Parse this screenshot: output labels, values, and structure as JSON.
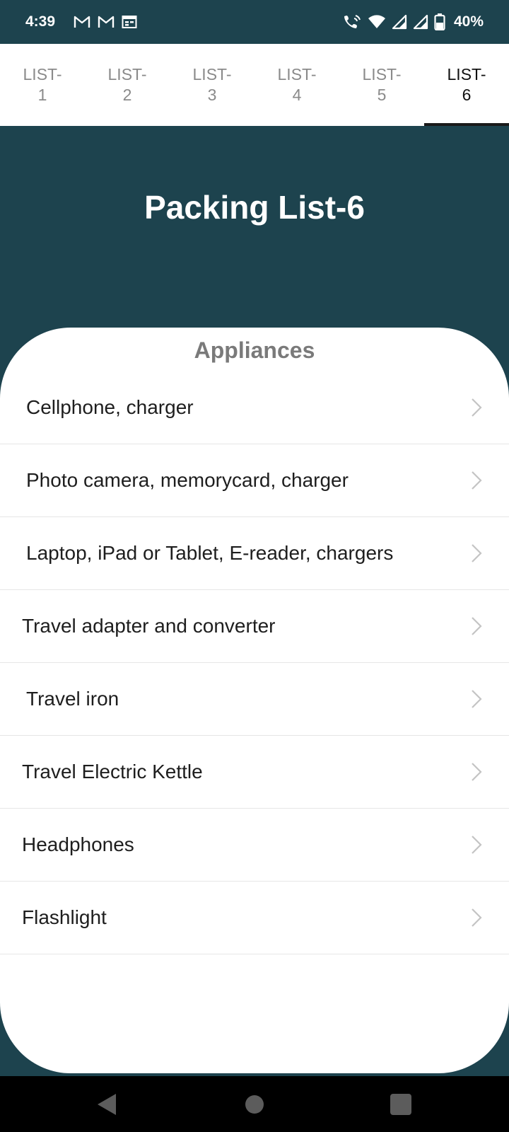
{
  "status_bar": {
    "time": "4:39",
    "battery": "40%",
    "left_icons": [
      "gmail-icon",
      "gmail-icon",
      "calendar-icon"
    ],
    "right_icons": [
      "wifi-calling-icon",
      "wifi-icon",
      "signal-icon",
      "signal-icon",
      "battery-icon"
    ]
  },
  "tabs": [
    {
      "line1": "LIST-",
      "line2": "1"
    },
    {
      "line1": "LIST-",
      "line2": "2"
    },
    {
      "line1": "LIST-",
      "line2": "3"
    },
    {
      "line1": "LIST-",
      "line2": "4"
    },
    {
      "line1": "LIST-",
      "line2": "5"
    },
    {
      "line1": "LIST-",
      "line2": "6"
    }
  ],
  "active_tab": "LIST-6",
  "header": {
    "title": "Packing List-6"
  },
  "section": {
    "title": "Appliances"
  },
  "items": [
    {
      "label": "Cellphone, charger"
    },
    {
      "label": "Photo camera, memorycard, charger"
    },
    {
      "label": "Laptop, iPad or Tablet, E-reader, chargers"
    },
    {
      "label": "Travel adapter and converter"
    },
    {
      "label": "Travel iron"
    },
    {
      "label": "Travel Electric Kettle"
    },
    {
      "label": "Headphones"
    },
    {
      "label": "Flashlight"
    }
  ],
  "colors": {
    "primary": "#1d434e",
    "card": "#ffffff",
    "tab_inactive": "#8a8a8a",
    "tab_active": "#111111",
    "section_title": "#7a7a7a",
    "chevron": "#c4c4c4"
  },
  "nav_bar": {
    "icons": [
      "back-icon",
      "home-icon",
      "recents-icon"
    ]
  }
}
